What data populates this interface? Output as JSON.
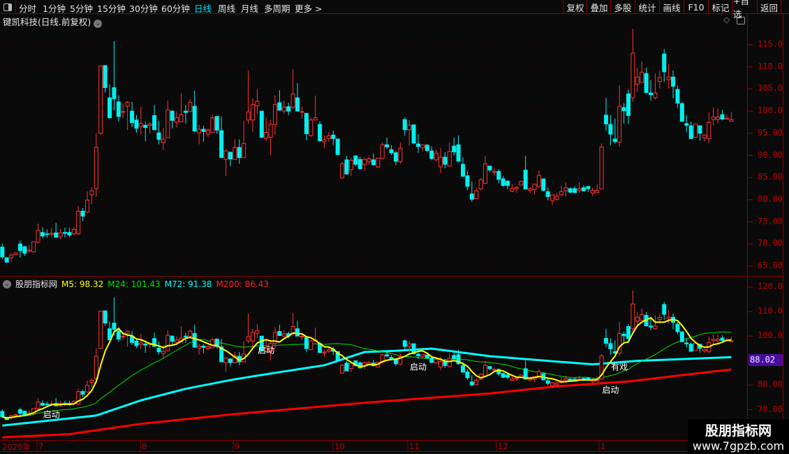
{
  "toolbar": {
    "tabs": [
      "分时",
      "1分钟",
      "5分钟",
      "15分钟",
      "30分钟",
      "60分钟",
      "日线",
      "周线",
      "月线",
      "多周期",
      "更多 >"
    ],
    "active_tab": "日线",
    "buttons": [
      "复权",
      "叠加",
      "多股",
      "统计",
      "画线",
      "F10",
      "标记",
      "+自选",
      "返回"
    ]
  },
  "header": {
    "title": "键凯科技(日线.前复权)"
  },
  "indicator": {
    "name": "股朋指标网",
    "m5": "M5: 98.32",
    "m24": "M24: 101.43",
    "m72": "M72: 91.38",
    "m200": "M200: 86.43"
  },
  "colors": {
    "up": "#ff3232",
    "down": "#00f0f0",
    "m5": "#ffff00",
    "m24": "#00e000",
    "m72": "#00ffff",
    "m200": "#ff0000",
    "axis": "#c00000",
    "grid": "#5a0000",
    "tag": "#4a0e9e"
  },
  "upper_axis": [
    "115.0",
    "110.0",
    "105.0",
    "100.0",
    "95.00",
    "90.00",
    "85.00",
    "80.00",
    "75.00",
    "70.00",
    "65.00"
  ],
  "lower_axis": [
    "120.0",
    "110.0",
    "100.0",
    "90.00",
    "80.00",
    "70.00"
  ],
  "price_tag": "88.02",
  "time_axis": {
    "year": "2025年",
    "months": [
      "7",
      "8",
      "9",
      "10",
      "11",
      "12",
      "1"
    ]
  },
  "watermark": {
    "line1": "股朋指标网",
    "line2": "www.7gpzb.com"
  },
  "chart_data": {
    "type": "candlestick",
    "upper_ylim": [
      65,
      115
    ],
    "lower_ylim": [
      60,
      120
    ],
    "grid": true,
    "candles_ohlc": [
      [
        69.3,
        70.1,
        66.6,
        67.1
      ],
      [
        66.9,
        67.0,
        65.7,
        65.9
      ],
      [
        66.9,
        67.9,
        65.9,
        67.5
      ],
      [
        67.6,
        68.1,
        67.5,
        68.0
      ],
      [
        70.0,
        70.8,
        66.9,
        68.5
      ],
      [
        69.4,
        69.5,
        67.3,
        67.9
      ],
      [
        68.4,
        69.7,
        68.0,
        68.6
      ],
      [
        68.2,
        70.6,
        68.2,
        70.5
      ],
      [
        70.4,
        74.6,
        70.1,
        73.1
      ],
      [
        72.6,
        73.8,
        71.3,
        71.8
      ],
      [
        72.3,
        73.3,
        71.4,
        72.2
      ],
      [
        72.2,
        73.7,
        71.5,
        72.4
      ],
      [
        72.5,
        74.8,
        71.5,
        71.5
      ],
      [
        71.6,
        73.4,
        71.1,
        72.5
      ],
      [
        72.6,
        73.7,
        71.5,
        72.4
      ],
      [
        72.6,
        73.7,
        71.5,
        72.0
      ],
      [
        72.3,
        73.8,
        71.9,
        73.3
      ],
      [
        72.3,
        78.5,
        72.0,
        77.4
      ],
      [
        77.4,
        78.1,
        75.2,
        76.3
      ],
      [
        77.2,
        81.9,
        77.0,
        79.9
      ],
      [
        81.1,
        82.8,
        79.0,
        82.0
      ],
      [
        82.5,
        95.0,
        80.7,
        91.8
      ],
      [
        95.0,
        110.2,
        94.7,
        110.2
      ],
      [
        110.3,
        110.3,
        104.2,
        105.3
      ],
      [
        103.0,
        106.0,
        98.3,
        98.5
      ],
      [
        105.3,
        115.8,
        100.2,
        102.8
      ],
      [
        102.1,
        103.6,
        97.7,
        98.8
      ],
      [
        99.8,
        101.8,
        98.5,
        99.9
      ],
      [
        101.1,
        102.3,
        95.7,
        102.0
      ],
      [
        100,
        102.1,
        96.4,
        97.4
      ],
      [
        98,
        99.1,
        95.1,
        96.1
      ],
      [
        96.6,
        101,
        94.8,
        97.2
      ],
      [
        96.8,
        97.6,
        93.2,
        96.3
      ],
      [
        96.8,
        97.5,
        95,
        97.1
      ],
      [
        99,
        101.4,
        95.7,
        95.8
      ],
      [
        95.1,
        97.8,
        92.5,
        93.6
      ],
      [
        92.9,
        96.2,
        91.2,
        93.7
      ],
      [
        94,
        102.4,
        94,
        100.3
      ],
      [
        100,
        100.2,
        96.1,
        97.9
      ],
      [
        97.5,
        99.9,
        96.3,
        98.5
      ],
      [
        97.6,
        104,
        97.6,
        99.2
      ],
      [
        100,
        101.4,
        97.2,
        99.7
      ],
      [
        99.9,
        102.7,
        99.8,
        102
      ],
      [
        101.1,
        104.6,
        95.2,
        95.5
      ],
      [
        95.1,
        96.9,
        92.5,
        95.9
      ],
      [
        95.9,
        96.7,
        93.1,
        95.4
      ],
      [
        94.8,
        96.1,
        94.2,
        95.7
      ],
      [
        95.2,
        99.2,
        95.2,
        98.5
      ],
      [
        98.8,
        98.8,
        94.9,
        95.7
      ],
      [
        95.6,
        98.8,
        89.5,
        89.5
      ],
      [
        89.1,
        91.4,
        85.4,
        91
      ],
      [
        90.7,
        90.9,
        87.6,
        89.2
      ],
      [
        89.1,
        93.6,
        89.1,
        91.8
      ],
      [
        91.8,
        93.6,
        88.1,
        89.5
      ],
      [
        89.5,
        97.8,
        89.5,
        92.7
      ],
      [
        98,
        109.2,
        97.1,
        99.8
      ],
      [
        98,
        102.9,
        95.3,
        101.5
      ],
      [
        101.2,
        104.9,
        99.3,
        102.2
      ],
      [
        100,
        100,
        93.8,
        94.1
      ],
      [
        93.9,
        98.6,
        93.3,
        95.2
      ],
      [
        94.1,
        98,
        90.1,
        97
      ],
      [
        97,
        103.6,
        94.7,
        101.5
      ],
      [
        101.9,
        104.7,
        100.2,
        100.2
      ],
      [
        100,
        102.4,
        99.4,
        100.9
      ],
      [
        101,
        101.9,
        99.1,
        100
      ],
      [
        100.9,
        109.5,
        100.4,
        103.9
      ],
      [
        103,
        106.3,
        100,
        100
      ],
      [
        99.8,
        101,
        98.3,
        99.9
      ],
      [
        99.5,
        99.5,
        93.4,
        94.9
      ],
      [
        94.5,
        98.5,
        94.2,
        98
      ],
      [
        98,
        103.5,
        98,
        98.5
      ],
      [
        97,
        97.7,
        93.1,
        93.3
      ],
      [
        93.1,
        94.5,
        91.7,
        93.5
      ],
      [
        93.8,
        95.3,
        93.1,
        94.4
      ],
      [
        94.6,
        95.6,
        92.3,
        93.8
      ],
      [
        93.7,
        93.7,
        90,
        90.2
      ],
      [
        84.9,
        88.6,
        84.8,
        88.1
      ],
      [
        89,
        89.9,
        85.7,
        85.8
      ],
      [
        86.8,
        89.4,
        85.4,
        88.9
      ],
      [
        89.9,
        89.9,
        87.6,
        88
      ],
      [
        89.1,
        89.7,
        87,
        87
      ],
      [
        87.9,
        89.5,
        86.5,
        89.1
      ],
      [
        88.6,
        89.8,
        87.9,
        89.2
      ],
      [
        89,
        90.4,
        87.7,
        87.9
      ],
      [
        87.4,
        89.4,
        87.1,
        89.4
      ],
      [
        89.3,
        92.9,
        89,
        92.4
      ],
      [
        92.4,
        94,
        91.4,
        91.9
      ],
      [
        91.3,
        92.3,
        90.1,
        90.6
      ],
      [
        90.6,
        91,
        87.8,
        88.7
      ],
      [
        88.6,
        92.9,
        88.1,
        91.6
      ],
      [
        98.1,
        98.6,
        94.4,
        95.8
      ],
      [
        95.8,
        98,
        92.2,
        96.8
      ],
      [
        96.9,
        96.9,
        92.5,
        92.8
      ],
      [
        92.6,
        94.8,
        90.6,
        92
      ],
      [
        91.7,
        92.4,
        90.9,
        92.4
      ],
      [
        92.3,
        92.6,
        90.8,
        91.1
      ],
      [
        91,
        92,
        88.9,
        89.3
      ],
      [
        89,
        91.3,
        88.7,
        90.5
      ],
      [
        87.4,
        91.7,
        86,
        89.6
      ],
      [
        89.6,
        90.7,
        87.1,
        88
      ],
      [
        87.6,
        92.9,
        87.6,
        90.9
      ],
      [
        92.1,
        94,
        90,
        90.8
      ],
      [
        92.4,
        94.5,
        88.4,
        88.7
      ],
      [
        88,
        89.6,
        85.1,
        85.3
      ],
      [
        85.4,
        86.5,
        82.1,
        83
      ],
      [
        81.3,
        84.1,
        79.5,
        80.1
      ],
      [
        80.2,
        82.7,
        80.1,
        82
      ],
      [
        82.4,
        84.8,
        82.1,
        84.5
      ],
      [
        83.7,
        89.9,
        83.7,
        88.1
      ],
      [
        87.6,
        87.6,
        86.2,
        86.7
      ],
      [
        86.2,
        87.2,
        85.4,
        86.4
      ],
      [
        86.4,
        86.9,
        83.7,
        84.6
      ],
      [
        84.7,
        85.3,
        82.9,
        83.2
      ],
      [
        84.2,
        84.4,
        82.4,
        83.2
      ],
      [
        81.9,
        83.5,
        81.7,
        82.5
      ],
      [
        82.5,
        83,
        81.6,
        82.8
      ],
      [
        83.3,
        84.4,
        83.2,
        84.1
      ],
      [
        86.7,
        89.9,
        82.3,
        82.4
      ],
      [
        82.1,
        82.8,
        81.5,
        82.5
      ],
      [
        82.3,
        83.5,
        81.2,
        83.5
      ],
      [
        83,
        86.6,
        82.7,
        85.5
      ],
      [
        84.7,
        84.7,
        81.9,
        82.1
      ],
      [
        81.8,
        82.8,
        79.8,
        80.7
      ],
      [
        79.8,
        81.2,
        78.8,
        81.1
      ],
      [
        80.1,
        81.5,
        79.7,
        80.8
      ],
      [
        81.1,
        83.2,
        80.8,
        81.8
      ],
      [
        82,
        83.9,
        80.7,
        82.7
      ],
      [
        82.5,
        82.8,
        81.4,
        81.7
      ],
      [
        82.5,
        83,
        81.5,
        81.6
      ],
      [
        82.1,
        83.9,
        81.5,
        82.5
      ],
      [
        82.7,
        83.3,
        81.9,
        82
      ],
      [
        83,
        83,
        81.7,
        82.5
      ],
      [
        81.5,
        82.7,
        80.8,
        82.1
      ],
      [
        81.6,
        83.5,
        81.6,
        82.1
      ],
      [
        82.4,
        92.7,
        82.4,
        91.9
      ],
      [
        99.1,
        103,
        95.5,
        97.1
      ],
      [
        97,
        99.1,
        92.3,
        94.8
      ],
      [
        93.7,
        98.3,
        92.6,
        93.1
      ],
      [
        93,
        105.8,
        92,
        101.1
      ],
      [
        100.8,
        101.8,
        97.2,
        100.1
      ],
      [
        103.9,
        104.9,
        97.1,
        99
      ],
      [
        103,
        118.6,
        102.1,
        113.1
      ],
      [
        106.1,
        109.8,
        104.3,
        107.7
      ],
      [
        106.5,
        111.2,
        106.5,
        108.8
      ],
      [
        108.5,
        109.8,
        103.9,
        104.2
      ],
      [
        104.1,
        107,
        102.4,
        103.7
      ],
      [
        103,
        108.5,
        102.6,
        104.1
      ],
      [
        106.7,
        109.2,
        105.1,
        107.6
      ],
      [
        112.9,
        114,
        106.6,
        108.9
      ],
      [
        107.1,
        110.7,
        105.1,
        107.7
      ],
      [
        107.7,
        109.2,
        102.9,
        105.6
      ],
      [
        104.9,
        105.8,
        100.7,
        101.8
      ],
      [
        101.7,
        102.1,
        97.6,
        97.7
      ],
      [
        97.2,
        99.1,
        95.3,
        96.8
      ],
      [
        96.7,
        97.6,
        93.8,
        93.8
      ],
      [
        94.1,
        97.1,
        94.1,
        97.1
      ],
      [
        96.7,
        96.7,
        93.3,
        95
      ],
      [
        94,
        94.8,
        93.1,
        94.6
      ],
      [
        93.8,
        99.8,
        92.8,
        97.4
      ],
      [
        98.1,
        100.8,
        96.7,
        98.7
      ],
      [
        98.1,
        100.6,
        97.2,
        98.7
      ],
      [
        99.2,
        100.3,
        97.9,
        98.2
      ],
      [
        98.2,
        99.2,
        98.2,
        98.4
      ],
      [
        97.7,
        99.8,
        97.7,
        98.1
      ]
    ],
    "m72_samples": [
      [
        0,
        63.5
      ],
      [
        21,
        67.6
      ],
      [
        31,
        73.8
      ],
      [
        41,
        78.5
      ],
      [
        52,
        82.4
      ],
      [
        62,
        85.3
      ],
      [
        72,
        88.1
      ],
      [
        81,
        93.5
      ],
      [
        88,
        94
      ],
      [
        96,
        94.9
      ],
      [
        109,
        91.8
      ],
      [
        124,
        89.6
      ],
      [
        132,
        88.5
      ],
      [
        142,
        89.9
      ],
      [
        163,
        91.4
      ]
    ],
    "m200_samples": [
      [
        0,
        58.7
      ],
      [
        15,
        60
      ],
      [
        31,
        64.2
      ],
      [
        52,
        68.2
      ],
      [
        81,
        72.8
      ],
      [
        109,
        76.6
      ],
      [
        124,
        79.5
      ],
      [
        140,
        81.5
      ],
      [
        163,
        86.4
      ]
    ],
    "annotations": [
      {
        "label": "启动",
        "index": 11,
        "price": 68.1
      },
      {
        "label": "启动",
        "index": 59,
        "price": 94.4
      },
      {
        "label": "启动",
        "index": 93,
        "price": 87.5
      },
      {
        "label": "启动",
        "index": 136,
        "price": 78.1
      },
      {
        "label": "有戏",
        "index": 138,
        "price": 87.5
      }
    ]
  }
}
